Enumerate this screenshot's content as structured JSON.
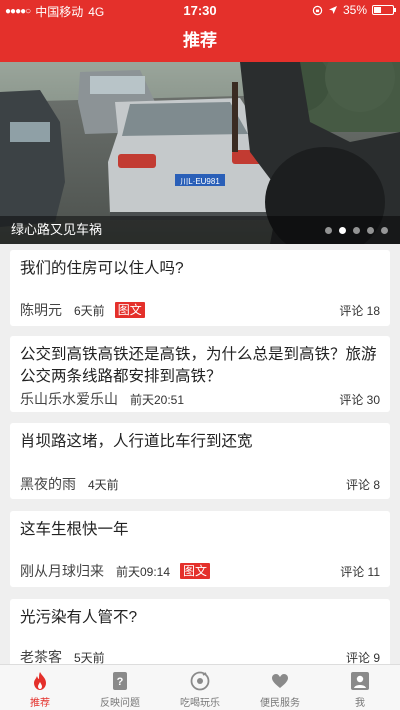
{
  "status_bar": {
    "signal": "●●●●○",
    "carrier": "中国移动",
    "network": "4G",
    "time": "17:30",
    "battery": "35%"
  },
  "nav": {
    "title": "推荐"
  },
  "banner": {
    "caption": "绿心路又见车祸",
    "plate": "川L·EU981",
    "page_count": 5,
    "active_page": 2
  },
  "feed": [
    {
      "title": "我们的住房可以住人吗?",
      "author": "陈明元",
      "time": "6天前",
      "tag": "图文",
      "comments": "评论 18"
    },
    {
      "title": "公交到高铁高铁还是高铁，为什么总是到高铁？旅游公交两条线路都安排到高铁？",
      "author": "乐山乐水爱乐山",
      "time": "前天20:51",
      "tag": "",
      "comments": "评论 30"
    },
    {
      "title": "肖坝路这堵，人行道比车行到还宽",
      "author": "黑夜的雨",
      "time": "4天前",
      "tag": "",
      "comments": "评论 8"
    },
    {
      "title": "这车生根快一年",
      "author": "刚从月球归来",
      "time": "前天09:14",
      "tag": "图文",
      "comments": "评论 11"
    },
    {
      "title": "光污染有人管不?",
      "author": "老茶客",
      "time": "5天前",
      "tag": "",
      "comments": "评论 9"
    }
  ],
  "tabs": [
    {
      "label": "推荐",
      "icon": "flame-icon",
      "active": true
    },
    {
      "label": "反映问题",
      "icon": "question-doc-icon",
      "active": false
    },
    {
      "label": "吃喝玩乐",
      "icon": "music-disc-icon",
      "active": false
    },
    {
      "label": "便民服务",
      "icon": "heart-hands-icon",
      "active": false
    },
    {
      "label": "我",
      "icon": "person-icon",
      "active": false
    }
  ],
  "colors": {
    "brand": "#e4302b",
    "background": "#efefef",
    "tab_inactive": "#777777"
  }
}
